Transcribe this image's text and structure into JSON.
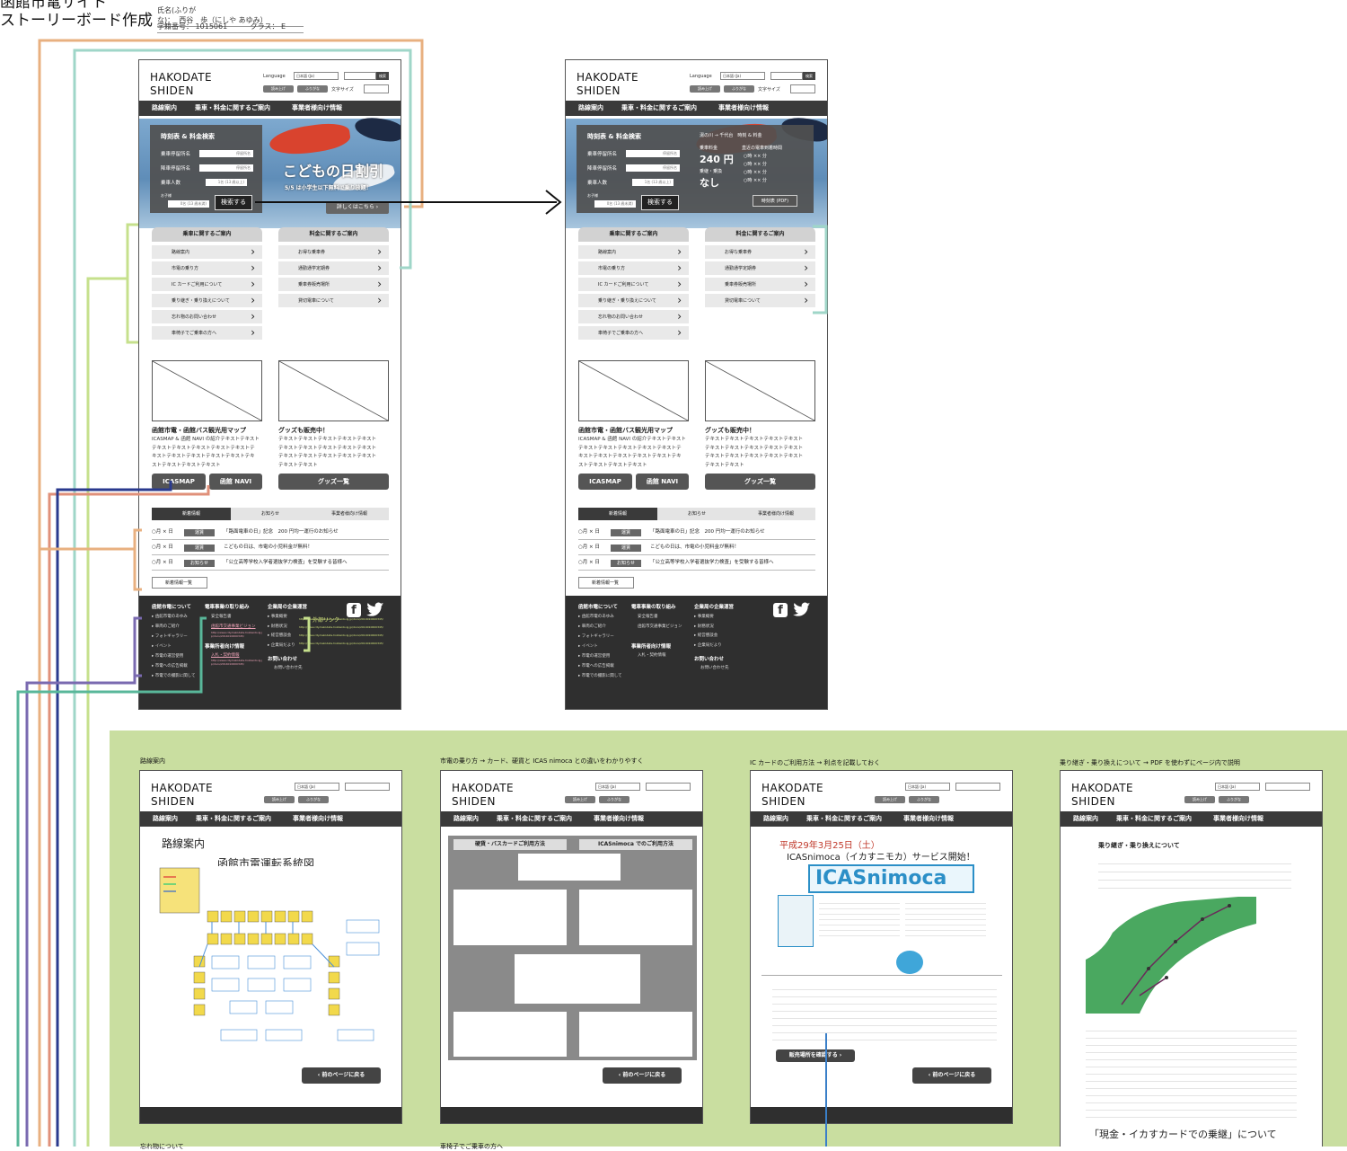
{
  "header": {
    "title": "函館市電サイト",
    "subtitle": "ストーリーボード作成",
    "name_label": "氏名(ふりがな)：",
    "name_value": "西谷　歩（にしや あゆみ）",
    "id_label": "学籍番号：",
    "id_value": "1015061",
    "class_label": "クラス：",
    "class_value": "E"
  },
  "site": {
    "brand_line1": "HAKODATE",
    "brand_line2": "SHIDEN",
    "language_label": "Language",
    "language_value": "日本語 (Ja)",
    "search_button": "検索",
    "read_aloud": "読み上げ",
    "furigana": "ふりがな",
    "font_size": "文字サイズ",
    "nav": [
      "路線案内",
      "乗車・料金に関するご案内",
      "事業者様向け情報"
    ]
  },
  "search_panel": {
    "title": "時刻表 & 料金検索",
    "from_label": "乗車停留所名",
    "to_label": "降車停留所名",
    "people_label": "乗車人数",
    "child_label": "お子様",
    "stop_placeholder": "停留所名",
    "count_text": "1名 (13 歳以上)",
    "child_count_text": "0名 (13 歳未満)",
    "search_button": "検索する",
    "hero_title": "こどもの日割引",
    "hero_sub": "5/5 は小学生以下無料で乗り放題！",
    "details_button": "詳しくはこちら"
  },
  "result_panel": {
    "route": "湯の川 → 千代台　時刻 & 料金",
    "fare_label": "乗車料金",
    "fare_value": "240 円",
    "transfer_label": "乗継・乗換",
    "transfer_value": "なし",
    "times_label": "直近の電車到着時間",
    "times": [
      "○時 ×× 分",
      "○時 ×× 分",
      "○時 ×× 分",
      "○時 ×× 分"
    ],
    "timetable_button": "時刻表 (PDF)"
  },
  "ride_menu": {
    "title": "乗車に関するご案内",
    "items": [
      "路線案内",
      "市電の乗り方",
      "IC カードご利用について",
      "乗り継ぎ・乗り換えについて",
      "忘れ物のお問い合わせ",
      "車椅子でご乗車の方へ"
    ]
  },
  "fare_menu": {
    "title": "料金に関するご案内",
    "items": [
      "お得な乗車券",
      "通勤通学定期券",
      "乗車券販売場所",
      "貸切電車について"
    ]
  },
  "promo": {
    "map_title": "函館市電・函館バス観光用マップ",
    "map_text": [
      "ICASMAP & 函館 NAVI の紹介テキストテキスト",
      "テキストテキストテキストテキストテキストテ",
      "キストテキストテキストテキストテキストテキ",
      "ストテキストテキストテキスト"
    ],
    "goods_title": "グッズも販売中！",
    "goods_text": [
      "テキストテキストテキストテキストテキスト",
      "テキストテキストテキストテキストテキスト",
      "テキストテキストテキストテキストテキスト",
      "テキストテキスト"
    ],
    "btn_icasmap": "ICASMAP",
    "btn_navi": "函館 NAVI",
    "btn_goods": "グッズ一覧"
  },
  "news": {
    "tabs": [
      "新着情報",
      "お知らせ",
      "事業者様向け情報"
    ],
    "rows": [
      {
        "date": "○月 × 日",
        "tag": "運賃",
        "text": "「路面電車の日」記念　200 円均一運行のお知らせ"
      },
      {
        "date": "○月 × 日",
        "tag": "運賃",
        "text": "こどもの日は、市電の小児料金が無料！"
      },
      {
        "date": "○月 × 日",
        "tag": "お知らせ",
        "text": "「公立高等学校入学者選抜学力検査」を受験する皆様へ"
      }
    ],
    "more": "新着情報一覧"
  },
  "footer": {
    "col1_title": "函館市電について",
    "col1_items": [
      "函館市電のあゆみ",
      "車両のご紹介",
      "フォトギャラリー",
      "イベント",
      "市電の運営使用",
      "市電への広告掲載",
      "市電での撮影に関して"
    ],
    "col2_title": "電車事業の取り組み",
    "col2_items": [
      "安全報告書",
      "函館市交通事業ビジョン"
    ],
    "col2_url1": "http://www.city.hakodate.hokkaido.lg.jp/docs/2014010600345/",
    "col2_sub_title": "事業所者向け情報",
    "col2_sub_items": [
      "入札・契約情報"
    ],
    "col2_url2": "http://www.city.hakodate.hokkaido.lg.jp/docs/2014010600345/",
    "col3_title": "企業局の企業運営",
    "col3_items": [
      "事業概要",
      "財務状況",
      "経営懇談会",
      "企業局だより"
    ],
    "contact_title": "お問い合わせ",
    "contact_item": "お問い合わせ先",
    "external_label": "外部リンク",
    "external_urls": [
      "http://www.city.hakodate.hokkaido.lg.jp/docs/2014010600345/",
      "http://www.city.hakodate.hokkaido.lg.jp/docs/2014010600345/",
      "http://www.city.hakodate.hokkaido.lg.jp/docs/2014010600345/",
      "http://www.city.hakodate.hokkaido.lg.jp/docs/2014010600345/"
    ]
  },
  "subpages": {
    "p1_caption": "路線案内",
    "p1_heading": "路線案内",
    "p1_map_title": "函館市電運転系統図",
    "p2_caption": "市電の乗り方 → カード、硬貨と ICAS nimoca との違いをわかりやすく",
    "p2_col1": "硬貨・バスカードご利用方法",
    "p2_col2": "ICASnimoca でのご利用方法",
    "p3_caption": "IC カードのご利用方法 → 利点を記載しておく",
    "p3_date": "平成29年3月25日（土）",
    "p3_service": "ICASnimoca（イカすニモカ）サービス開始！",
    "p3_logo": "ICASnimoca",
    "p3_btn": "販売場所を確認する",
    "p4_caption": "乗り継ぎ・乗り換えについて → PDF を使わずにページ内で説明",
    "p4_heading": "乗り継ぎ・乗り換えについて",
    "p4_bottom": "「現金・イカすカードでの乗継」について",
    "back_button": "前のページに戻る",
    "bottom_caption_1": "忘れ物について",
    "bottom_caption_2": "車椅子でご乗車の方へ"
  },
  "colors": {
    "orange": "#e8b080",
    "teal": "#9fd6c8",
    "lime": "#c6e08c",
    "navy": "#2a3a8e",
    "purple": "#7a6ab0",
    "salmon": "#e0907a",
    "green_bg": "#c9dea0",
    "dark": "#3a3a3a"
  }
}
